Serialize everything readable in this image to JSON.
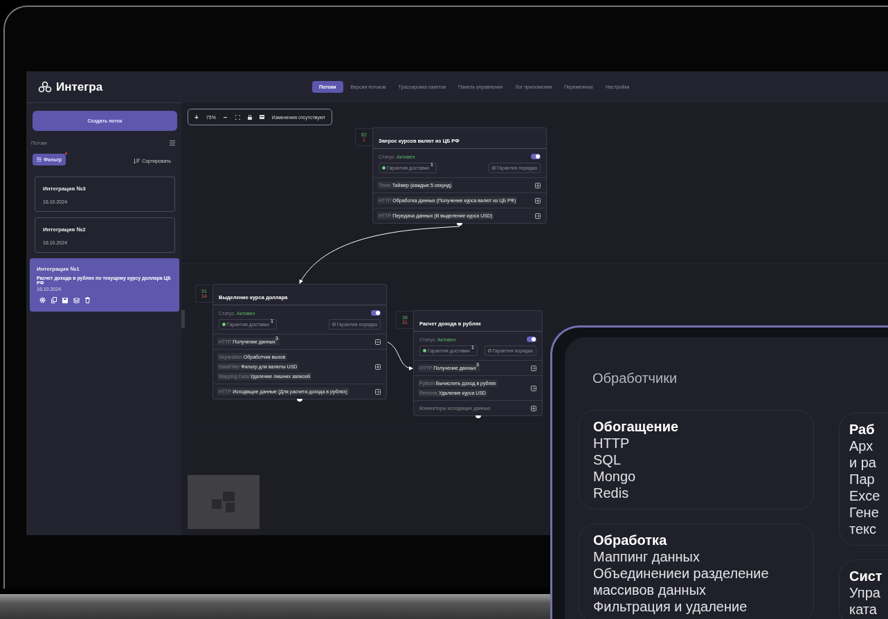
{
  "app": {
    "logo": "Интегра"
  },
  "tabs": [
    {
      "label": "Потоки",
      "selected": true
    },
    {
      "label": "Версии потоков",
      "selected": false
    },
    {
      "label": "Трассировка пакетов",
      "selected": false
    },
    {
      "label": "Панель управления",
      "selected": false
    },
    {
      "label": "Лог приложения",
      "selected": false
    },
    {
      "label": "Переменные",
      "selected": false
    },
    {
      "label": "Настройки",
      "selected": false
    }
  ],
  "sidebar": {
    "create_button": "Создать поток",
    "section_title": "Потоки",
    "filter_button": "Фильтр",
    "filter_active": true,
    "sort_button": "Сортировать",
    "integrations": [
      {
        "name": "Интеграция №3",
        "date": "16.10.2024",
        "selected": false
      },
      {
        "name": "Интеграция №2",
        "date": "16.10.2024",
        "selected": false
      },
      {
        "name": "Интеграция №1",
        "description": "Расчет дохода в рублях по текущему курсу доллара ЦБ РФ",
        "date": "16.10.2024",
        "selected": true
      }
    ]
  },
  "toolbar": {
    "zoom_in": "+",
    "zoom": "75%",
    "zoom_out": "−",
    "status": "Изменения отсутствуют"
  },
  "nodes": [
    {
      "in_count": "82",
      "out_count": "1",
      "title": "Запрос курсов валют из ЦБ РФ",
      "status_label": "Статус:",
      "status_value": "Активен",
      "enabled": true,
      "guarantees": [
        {
          "label": "Гарантия доставки",
          "on": true,
          "count": "1"
        },
        {
          "label": "Гарантия порядка",
          "on": false
        }
      ],
      "sections": [
        {
          "steps": [
            {
              "type": "Timer",
              "label": "Таймер (каждые 5 секунд)"
            }
          ],
          "kind": "expand"
        },
        {
          "steps": [
            {
              "type": "HTTP",
              "label": "Обработка данных (Получение курса валют из ЦБ РФ)"
            }
          ],
          "kind": "expand"
        },
        {
          "steps": [
            {
              "type": "HTTP",
              "label": "Передача данных (В выделение курса USD)"
            }
          ],
          "kind": "link"
        }
      ]
    },
    {
      "in_count": "91",
      "out_count": "14",
      "title": "Выделение курса доллара",
      "status_label": "Статус:",
      "status_value": "Активен",
      "enabled": true,
      "guarantees": [
        {
          "label": "Гарантия доставки",
          "on": true,
          "count": "1"
        },
        {
          "label": "Гарантия порядка",
          "on": false
        }
      ],
      "sections": [
        {
          "steps": [
            {
              "type": "HTTP",
              "label": "Получение данных",
              "count": "3"
            }
          ],
          "kind": "collapse"
        },
        {
          "steps": [
            {
              "type": "Separation",
              "label": "Обработчик вызов"
            },
            {
              "type": "DataFilter",
              "label": "Фильтр для валюты USD"
            },
            {
              "type": "Mapping Data",
              "label": "Удаление лишних записей"
            }
          ],
          "kind": "expand"
        },
        {
          "steps": [
            {
              "type": "HTTP",
              "label": "Исходящие данные (Для расчета дохода в рублях)"
            }
          ],
          "kind": "link"
        }
      ]
    },
    {
      "in_count": "38",
      "out_count": "31",
      "title": "Расчет дохода в рублях",
      "status_label": "Статус:",
      "status_value": "Активен",
      "enabled": true,
      "guarantees": [
        {
          "label": "Гарантия доставки",
          "on": true,
          "count": "1"
        },
        {
          "label": "Гарантия порядка",
          "on": false
        }
      ],
      "sections": [
        {
          "steps": [
            {
              "type": "HTTP",
              "label": "Получение данных",
              "count": "3"
            }
          ],
          "kind": "link"
        },
        {
          "steps": [
            {
              "type": "Python",
              "label": "Вычислить доход в рублях"
            },
            {
              "type": "Remove",
              "label": "Удаление курса USD"
            }
          ],
          "kind": "link"
        },
        {
          "steps": [
            {
              "label": "Коннекторы исходящих данных"
            }
          ],
          "kind": "expand"
        }
      ]
    }
  ],
  "handlers_panel": {
    "title": "Обработчики",
    "columns": [
      [
        {
          "title": "Обогащение",
          "items": [
            "HTTP",
            "SQL",
            "Mongo",
            "Redis"
          ]
        },
        {
          "title": "Обработка",
          "items": [
            "Маппинг данных",
            "Объединениеи разделение",
            "массивов данных",
            "Фильтрация и удаление"
          ]
        }
      ],
      [
        {
          "title": "Раб",
          "items": [
            "Арх",
            "и ра",
            "Пар",
            "Exce",
            "Гене",
            "текс"
          ]
        },
        {
          "title": "Сист",
          "items": [
            "Упра",
            "ката"
          ]
        }
      ]
    ]
  }
}
